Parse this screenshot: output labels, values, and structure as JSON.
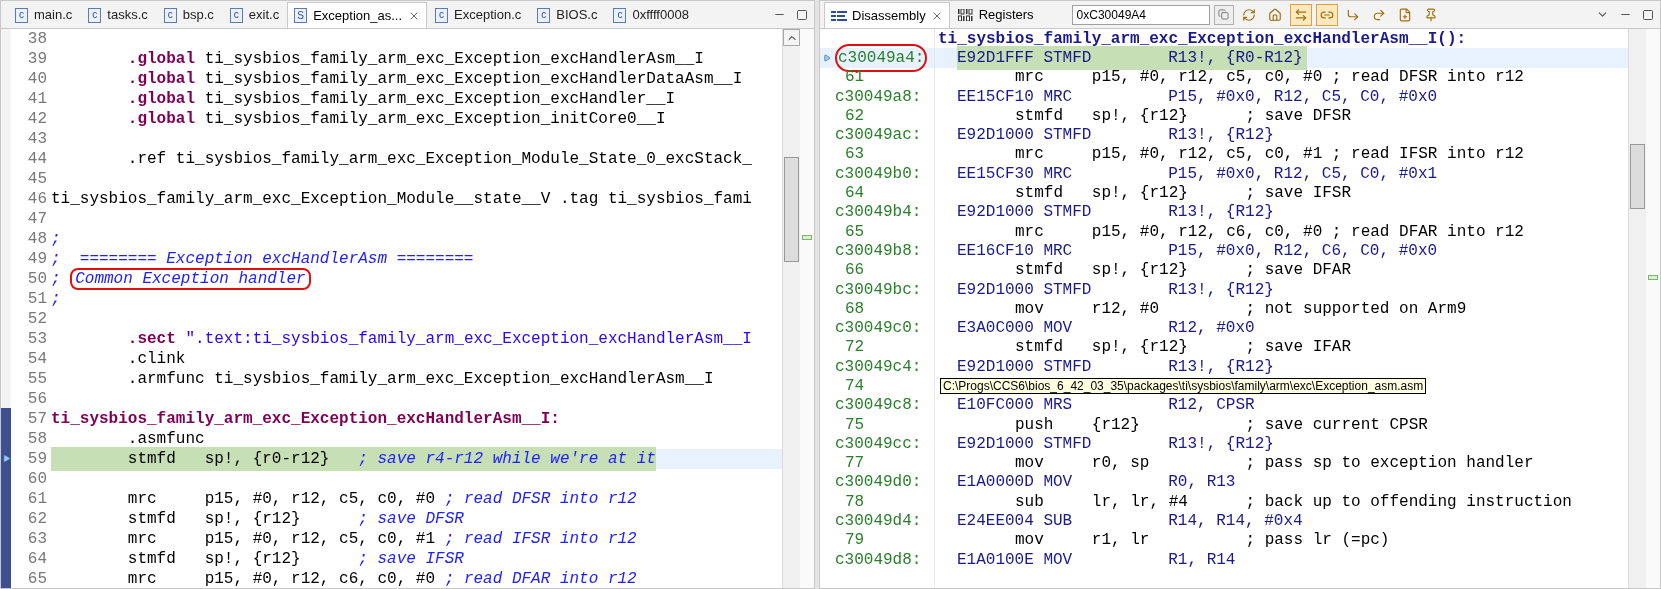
{
  "editor": {
    "tabs": [
      {
        "label": "main.c",
        "icon": "c",
        "selected": false,
        "closable": false
      },
      {
        "label": "tasks.c",
        "icon": "c",
        "selected": false,
        "closable": false
      },
      {
        "label": "bsp.c",
        "icon": "c",
        "selected": false,
        "closable": false
      },
      {
        "label": "exit.c",
        "icon": "c",
        "selected": false,
        "closable": false
      },
      {
        "label": "Exception_as...",
        "icon": "S",
        "selected": true,
        "closable": true
      },
      {
        "label": "Exception.c",
        "icon": "c",
        "selected": false,
        "closable": false
      },
      {
        "label": "BIOS.c",
        "icon": "c",
        "selected": false,
        "closable": false
      },
      {
        "label": "0xffff0008",
        "icon": "c",
        "selected": false,
        "closable": false
      }
    ],
    "lines": [
      {
        "number": "38",
        "marked": false,
        "current": false
      },
      {
        "number": "39",
        "marked": false,
        "current": false,
        "segments": [
          {
            "kind": "keyword",
            "text": "        .global"
          },
          {
            "kind": "plain",
            "text": " ti_sysbios_family_arm_exc_Exception_excHandlerAsm__I"
          }
        ]
      },
      {
        "number": "40",
        "marked": false,
        "current": false,
        "segments": [
          {
            "kind": "keyword",
            "text": "        .global"
          },
          {
            "kind": "plain",
            "text": " ti_sysbios_family_arm_exc_Exception_excHandlerDataAsm__I"
          }
        ]
      },
      {
        "number": "41",
        "marked": false,
        "current": false,
        "segments": [
          {
            "kind": "keyword",
            "text": "        .global"
          },
          {
            "kind": "plain",
            "text": " ti_sysbios_family_arm_exc_Exception_excHandler__I"
          }
        ]
      },
      {
        "number": "42",
        "marked": false,
        "current": false,
        "segments": [
          {
            "kind": "keyword",
            "text": "        .global"
          },
          {
            "kind": "plain",
            "text": " ti_sysbios_family_arm_exc_Exception_initCore0__I"
          }
        ]
      },
      {
        "number": "43",
        "marked": false,
        "current": false
      },
      {
        "number": "44",
        "marked": false,
        "current": false,
        "segments": [
          {
            "kind": "plain",
            "text": "        .ref ti_sysbios_family_arm_exc_Exception_Module_State_0_excStack_"
          }
        ]
      },
      {
        "number": "45",
        "marked": false,
        "current": false
      },
      {
        "number": "46",
        "marked": false,
        "current": false,
        "segments": [
          {
            "kind": "plain",
            "text": "ti_sysbios_family_arm_exc_Exception_Module__state__V .tag ti_sysbios_fami"
          }
        ]
      },
      {
        "number": "47",
        "marked": false,
        "current": false
      },
      {
        "number": "48",
        "marked": false,
        "current": false,
        "segments": [
          {
            "kind": "comment",
            "text": ";"
          }
        ]
      },
      {
        "number": "49",
        "marked": false,
        "current": false,
        "segments": [
          {
            "kind": "comment",
            "text": ";  ======== Exception excHandlerAsm ========"
          }
        ]
      },
      {
        "number": "50",
        "marked": false,
        "current": false,
        "segments": [
          {
            "kind": "comment",
            "text": "; "
          },
          {
            "kind": "comment",
            "text": "Common Exception handler",
            "annotated": true
          }
        ]
      },
      {
        "number": "51",
        "marked": false,
        "current": false,
        "segments": [
          {
            "kind": "comment",
            "text": ";"
          }
        ]
      },
      {
        "number": "52",
        "marked": false,
        "current": false
      },
      {
        "number": "53",
        "marked": false,
        "current": false,
        "segments": [
          {
            "kind": "keyword",
            "text": "        .sect"
          },
          {
            "kind": "string",
            "text": " \".text:ti_sysbios_family_arm_exc_Exception_excHandlerAsm__I"
          }
        ]
      },
      {
        "number": "54",
        "marked": false,
        "current": false,
        "segments": [
          {
            "kind": "plain",
            "text": "        .clink"
          }
        ]
      },
      {
        "number": "55",
        "marked": false,
        "current": false,
        "segments": [
          {
            "kind": "plain",
            "text": "        .armfunc ti_sysbios_family_arm_exc_Exception_excHandlerAsm__I"
          }
        ]
      },
      {
        "number": "56",
        "marked": false,
        "current": false
      },
      {
        "number": "57",
        "marked": true,
        "current": false,
        "segments": [
          {
            "kind": "label",
            "text": "ti_sysbios_family_arm_exc_Exception_excHandlerAsm__I:"
          }
        ]
      },
      {
        "number": "58",
        "marked": true,
        "current": false,
        "segments": [
          {
            "kind": "plain",
            "text": "        .asmfunc"
          }
        ]
      },
      {
        "number": "59",
        "marked": true,
        "current": true,
        "segments": [
          {
            "kind": "plain",
            "text": "        stmfd   sp!, {r0-r12}   "
          },
          {
            "kind": "comment",
            "text": "; save r4-r12 while we're at it"
          }
        ]
      },
      {
        "number": "60",
        "marked": true,
        "current": false
      },
      {
        "number": "61",
        "marked": true,
        "current": false,
        "segments": [
          {
            "kind": "plain",
            "text": "        mrc     p15, #0, r12, c5, c0, #0 "
          },
          {
            "kind": "comment",
            "text": "; read DFSR into r12"
          }
        ]
      },
      {
        "number": "62",
        "marked": true,
        "current": false,
        "segments": [
          {
            "kind": "plain",
            "text": "        stmfd   sp!, {r12}      "
          },
          {
            "kind": "comment",
            "text": "; save DFSR"
          }
        ]
      },
      {
        "number": "63",
        "marked": true,
        "current": false,
        "segments": [
          {
            "kind": "plain",
            "text": "        mrc     p15, #0, r12, c5, c0, #1 "
          },
          {
            "kind": "comment",
            "text": "; read IFSR into r12"
          }
        ]
      },
      {
        "number": "64",
        "marked": true,
        "current": false,
        "segments": [
          {
            "kind": "plain",
            "text": "        stmfd   sp!, {r12}      "
          },
          {
            "kind": "comment",
            "text": "; save IFSR"
          }
        ]
      },
      {
        "number": "65",
        "marked": true,
        "current": false,
        "segments": [
          {
            "kind": "plain",
            "text": "        mrc     p15, #0, r12, c6, c0, #0 "
          },
          {
            "kind": "comment",
            "text": "; read DFAR into r12"
          }
        ]
      }
    ]
  },
  "disassembly": {
    "tabs": [
      {
        "label": "Disassembly",
        "selected": true,
        "closable": true
      },
      {
        "label": "Registers",
        "selected": false,
        "closable": false
      }
    ],
    "address_field": {
      "value": "0xC30049A4"
    },
    "toolbar": [
      {
        "pressed": false
      },
      {
        "pressed": false
      },
      {
        "pressed": true
      },
      {
        "pressed": true
      },
      {
        "pressed": false
      },
      {
        "pressed": false
      },
      {
        "pressed": false
      },
      {
        "pressed": false
      }
    ],
    "function_label": "ti_sysbios_family_arm_exc_Exception_excHandlerAsm__I():",
    "rows": [
      {
        "kind": "instruction",
        "address": "c30049a4:",
        "text": "E92D1FFF STMFD        R13!, {R0-R12}",
        "current": true,
        "annotated": true
      },
      {
        "kind": "source",
        "line": "61",
        "text": "mrc     p15, #0, r12, c5, c0, #0 ; read DFSR into r12"
      },
      {
        "kind": "instruction",
        "address": "c30049a8:",
        "text": "EE15CF10 MRC          P15, #0x0, R12, C5, C0, #0x0",
        "current": false,
        "annotated": false
      },
      {
        "kind": "source",
        "line": "62",
        "text": "stmfd   sp!, {r12}      ; save DFSR"
      },
      {
        "kind": "instruction",
        "address": "c30049ac:",
        "text": "E92D1000 STMFD        R13!, {R12}",
        "current": false,
        "annotated": false
      },
      {
        "kind": "source",
        "line": "63",
        "text": "mrc     p15, #0, r12, c5, c0, #1 ; read IFSR into r12"
      },
      {
        "kind": "instruction",
        "address": "c30049b0:",
        "text": "EE15CF30 MRC          P15, #0x0, R12, C5, C0, #0x1",
        "current": false,
        "annotated": false
      },
      {
        "kind": "source",
        "line": "64",
        "text": "stmfd   sp!, {r12}      ; save IFSR"
      },
      {
        "kind": "instruction",
        "address": "c30049b4:",
        "text": "E92D1000 STMFD        R13!, {R12}",
        "current": false,
        "annotated": false
      },
      {
        "kind": "source",
        "line": "65",
        "text": "mrc     p15, #0, r12, c6, c0, #0 ; read DFAR into r12"
      },
      {
        "kind": "instruction",
        "address": "c30049b8:",
        "text": "EE16CF10 MRC          P15, #0x0, R12, C6, C0, #0x0",
        "current": false,
        "annotated": false
      },
      {
        "kind": "source",
        "line": "66",
        "text": "stmfd   sp!, {r12}      ; save DFAR"
      },
      {
        "kind": "instruction",
        "address": "c30049bc:",
        "text": "E92D1000 STMFD        R13!, {R12}",
        "current": false,
        "annotated": false
      },
      {
        "kind": "source",
        "line": "68",
        "text": "mov     r12, #0         ; not supported on Arm9"
      },
      {
        "kind": "instruction",
        "address": "c30049c0:",
        "text": "E3A0C000 MOV          R12, #0x0",
        "current": false,
        "annotated": false
      },
      {
        "kind": "source",
        "line": "72",
        "text": "stmfd   sp!, {r12}      ; save IFAR"
      },
      {
        "kind": "instruction",
        "address": "c30049c4:",
        "text": "E92D1000 STMFD        R13!, {R12}",
        "current": false,
        "annotated": false
      },
      {
        "kind": "source",
        "line": "74",
        "tooltip": "C:\\Progs\\CCS6\\bios_6_42_03_35\\packages\\ti\\sysbios\\family\\arm\\exc\\Exception_asm.asm"
      },
      {
        "kind": "instruction",
        "address": "c30049c8:",
        "text": "E10FC000 MRS          R12, CPSR",
        "current": false,
        "annotated": false
      },
      {
        "kind": "source",
        "line": "75",
        "text": "push    {r12}           ; save current CPSR"
      },
      {
        "kind": "instruction",
        "address": "c30049cc:",
        "text": "E92D1000 STMFD        R13!, {R12}",
        "current": false,
        "annotated": false
      },
      {
        "kind": "source",
        "line": "77",
        "text": "mov     r0, sp          ; pass sp to exception handler"
      },
      {
        "kind": "instruction",
        "address": "c30049d0:",
        "text": "E1A0000D MOV          R0, R13",
        "current": false,
        "annotated": false
      },
      {
        "kind": "source",
        "line": "78",
        "text": "sub     lr, lr, #4      ; back up to offending instruction"
      },
      {
        "kind": "instruction",
        "address": "c30049d4:",
        "text": "E24EE004 SUB          R14, R14, #0x4",
        "current": false,
        "annotated": false
      },
      {
        "kind": "source",
        "line": "79",
        "text": "mov     r1, lr          ; pass lr (=pc)"
      },
      {
        "kind": "instruction",
        "address": "c30049d8:",
        "text": "E1A0100E MOV          R1, R14",
        "current": false,
        "annotated": false
      }
    ]
  }
}
